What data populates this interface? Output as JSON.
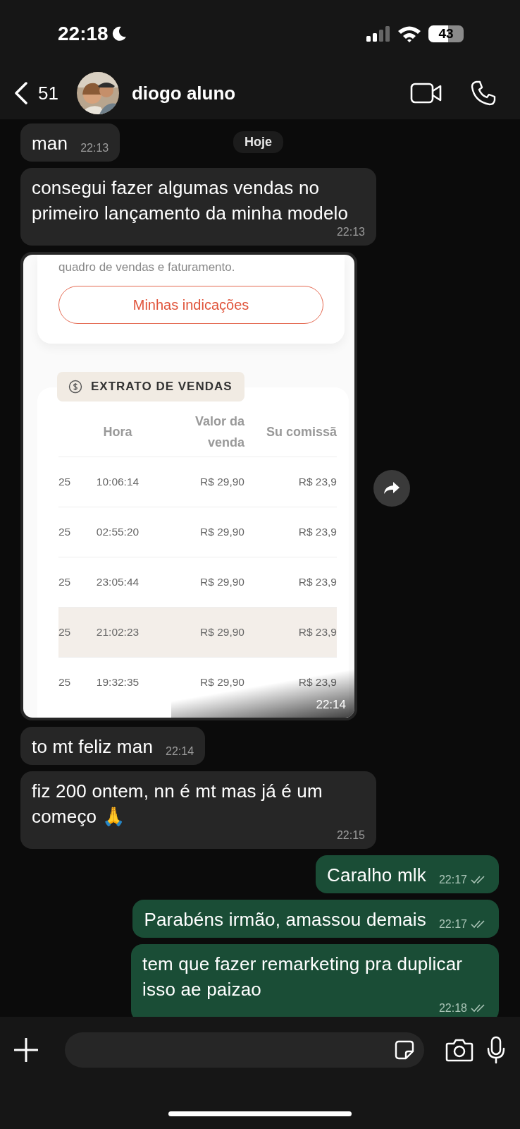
{
  "status_bar": {
    "time": "22:18",
    "battery": "43"
  },
  "header": {
    "back_count": "51",
    "contact_name": "diogo aluno"
  },
  "date_pill": "Hoje",
  "messages": [
    {
      "kind": "incoming",
      "text": "man",
      "time": "22:13"
    },
    {
      "kind": "incoming",
      "text": "consegui fazer algumas vendas no primeiro lançamento da minha modelo",
      "time": "22:13"
    },
    {
      "time": "22:14",
      "screenshot": {
        "caption": "quadro de vendas e faturamento.",
        "button": "Minhas indicações",
        "section_title": "EXTRATO DE VENDAS",
        "columns": [
          "",
          "Hora",
          "Valor da venda",
          "Su comissã"
        ],
        "rows": [
          {
            "cells": [
              "25",
              "10:06:14",
              "R$ 29,90",
              "R$ 23,9"
            ],
            "highlighted": false
          },
          {
            "cells": [
              "25",
              "02:55:20",
              "R$ 29,90",
              "R$ 23,9"
            ],
            "highlighted": false
          },
          {
            "cells": [
              "25",
              "23:05:44",
              "R$ 29,90",
              "R$ 23,9"
            ],
            "highlighted": false
          },
          {
            "cells": [
              "25",
              "21:02:23",
              "R$ 29,90",
              "R$ 23,9"
            ],
            "highlighted": true
          },
          {
            "cells": [
              "25",
              "19:32:35",
              "R$ 29,90",
              "R$ 23,9"
            ],
            "highlighted": false
          }
        ]
      }
    },
    {
      "kind": "incoming",
      "text": "to mt feliz man",
      "time": "22:14"
    },
    {
      "kind": "incoming",
      "text": "fiz 200 ontem, nn é mt mas já é um começo 🙏",
      "time": "22:15"
    },
    {
      "kind": "outgoing",
      "text": "Caralho mlk",
      "time": "22:17",
      "delivered": true
    },
    {
      "kind": "outgoing",
      "text": "Parabéns irmão, amassou demais",
      "time": "22:17",
      "delivered": true
    },
    {
      "kind": "outgoing",
      "text": "tem que fazer remarketing pra duplicar isso ae paizao",
      "time": "22:18",
      "delivered": true
    }
  ]
}
